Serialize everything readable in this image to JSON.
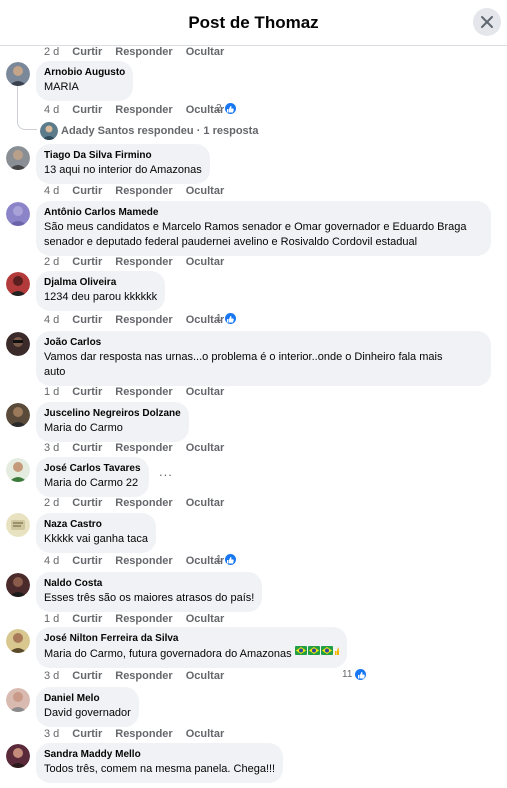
{
  "header": {
    "title": "Post de Thomaz"
  },
  "labels": {
    "like": "Curtir",
    "reply": "Responder",
    "hide": "Ocultar"
  },
  "top_time": "2 d",
  "reply_summary": {
    "text": "Adady Santos respondeu · 1 resposta"
  },
  "comments": [
    {
      "name": "Arnobio Augusto",
      "lines": [
        "MARIA"
      ],
      "time": "4 d",
      "likes": "2",
      "avatar_color": "#6b7b8c"
    },
    {
      "name": "Tiago Da Silva Firmino",
      "lines": [
        "13 aqui no interior do Amazonas"
      ],
      "time": "4 d",
      "likes": "",
      "avatar_color": "#8a8f96"
    },
    {
      "name": "Antônio Carlos Mamede",
      "lines": [
        "São meus candidatos e Marcelo Ramos senador e Omar governador e Eduardo Braga",
        "senador e deputado federal paudernei avelino e Rosivaldo Cordovil estadual"
      ],
      "time": "2 d",
      "likes": "",
      "avatar_color": "#8c84c9"
    },
    {
      "name": "Djalma Oliveira",
      "lines": [
        "1234 deu parou kkkkkk"
      ],
      "time": "4 d",
      "likes": "1",
      "avatar_color": "#b33a3a"
    },
    {
      "name": "João Carlos",
      "lines": [
        "Vamos dar resposta nas urnas...o problema é o interior..onde o Dinheiro fala mais",
        "auto"
      ],
      "time": "1 d",
      "likes": "",
      "avatar_color": "#3b2a2a"
    },
    {
      "name": "Juscelino Negreiros Dolzane",
      "lines": [
        "Maria do Carmo"
      ],
      "time": "3 d",
      "likes": "",
      "avatar_color": "#5a4a3a"
    },
    {
      "name": "José Carlos Tavares",
      "lines": [
        "Maria do Carmo 22"
      ],
      "time": "2 d",
      "likes": "",
      "avatar_color": "#d9e3d0"
    },
    {
      "name": "Naza Castro",
      "lines": [
        "Kkkkk vai ganha taca"
      ],
      "time": "4 d",
      "likes": "1",
      "avatar_color": "#cfc7a0"
    },
    {
      "name": "Naldo Costa",
      "lines": [
        "Esses três são os maiores atrasos do país!"
      ],
      "time": "1 d",
      "likes": "",
      "avatar_color": "#4a2a2a"
    },
    {
      "name": "José Nilton Ferreira da Silva",
      "lines": [
        "Maria do Carmo, futura governadora do Amazonas"
      ],
      "time": "3 d",
      "likes": "11",
      "avatar_color": "#b8a070"
    },
    {
      "name": "Daniel Melo",
      "lines": [
        "David governador"
      ],
      "time": "3 d",
      "likes": "",
      "avatar_color": "#c9a9a0"
    },
    {
      "name": "Sandra Maddy Mello",
      "lines": [
        "Todos três, comem na mesma panela. Chega!!!"
      ],
      "time": "",
      "likes": "",
      "avatar_color": "#5a2a3a"
    }
  ],
  "icons": {
    "close": "close-icon",
    "like": "like-icon",
    "more": "more-icon"
  },
  "more_label": "...",
  "colors": {
    "accent": "#1877f2",
    "bubble": "#f0f2f5",
    "meta": "#65676b"
  }
}
